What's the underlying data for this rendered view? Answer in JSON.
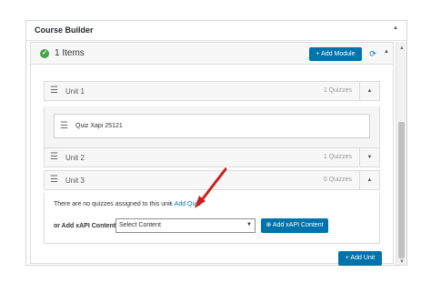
{
  "panel": {
    "title": "Course Builder",
    "collapse_icon": "triangle-up-icon"
  },
  "items_bar": {
    "count_label": "1 Items",
    "add_module_label": "+ Add Module",
    "refresh_icon": "refresh-icon",
    "status_color": "#46a546",
    "accent_color": "#0073aa"
  },
  "units": [
    {
      "label": "Unit 1",
      "quizzes": "1 Quizzes",
      "expanded": true
    },
    {
      "label": "Unit 2",
      "quizzes": "1 Quizzes",
      "expanded": false
    },
    {
      "label": "Unit 3",
      "quizzes": "0 Quizzes",
      "expanded": true
    }
  ],
  "quiz": {
    "label": "Quiz Xapi 25121"
  },
  "unit3": {
    "no_quiz_text": "There are no quizzes assigned to this unit.",
    "add_quiz_label": "+ Add Quiz",
    "xapi_label": "or Add xAPI Content",
    "select_value": "Select Content",
    "add_xapi_label": "Add xAPI Content"
  },
  "add_unit_label": "+ Add Unit",
  "annotation_color": "#cc1f1f"
}
